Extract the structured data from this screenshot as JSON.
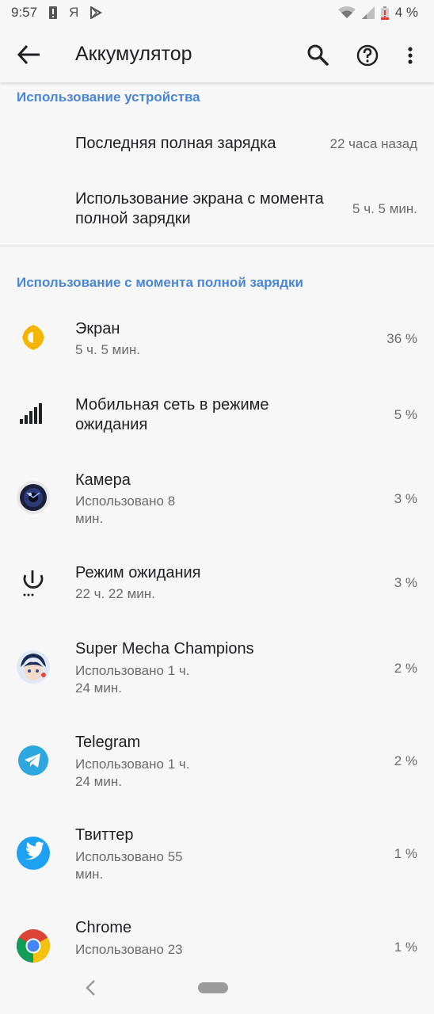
{
  "status_bar": {
    "time": "9:57",
    "notif_icons": [
      "alert-icon",
      "yandex-icon",
      "play-store-icon"
    ],
    "battery_percent": "4 %"
  },
  "app_bar": {
    "title": "Аккумулятор"
  },
  "device_usage": {
    "header": "Использование устройства",
    "rows": [
      {
        "title": "Последняя полная зарядка",
        "value": "22 часа назад"
      },
      {
        "title": "Использование экрана с момента полной зарядки",
        "title_line1": "Использование экрана с момента",
        "title_line2": "полной зарядки",
        "value": "5 ч. 5 мин."
      }
    ]
  },
  "since_full_charge": {
    "header": "Использование с момента полной зарядки",
    "items": [
      {
        "icon": "brightness-icon",
        "title": "Экран",
        "subtitle": "5 ч. 5 мин.",
        "percent": "36 %"
      },
      {
        "icon": "cell-signal-icon",
        "title_line1": "Мобильная сеть в режиме",
        "title_line2": "ожидания",
        "percent": "5 %"
      },
      {
        "icon": "camera-app-icon",
        "title": "Камера",
        "subtitle_line1": "Использовано 8",
        "subtitle_line2": "мин.",
        "percent": "3 %"
      },
      {
        "icon": "power-icon",
        "title": "Режим ожидания",
        "subtitle": "22 ч. 22 мин.",
        "percent": "3 %"
      },
      {
        "icon": "super-mecha-champions-app-icon",
        "title": "Super Mecha Champions",
        "subtitle_line1": "Использовано 1 ч.",
        "subtitle_line2": "24 мин.",
        "percent": "2 %"
      },
      {
        "icon": "telegram-app-icon",
        "title": "Telegram",
        "subtitle_line1": "Использовано 1 ч.",
        "subtitle_line2": "24 мин.",
        "percent": "2 %"
      },
      {
        "icon": "twitter-app-icon",
        "title": "Твиттер",
        "subtitle_line1": "Использовано 55",
        "subtitle_line2": "мин.",
        "percent": "1 %"
      },
      {
        "icon": "chrome-app-icon",
        "title": "Chrome",
        "subtitle_line1": "Использовано 23",
        "percent": "1 %"
      }
    ]
  },
  "colors": {
    "accent": "#4a86d8",
    "background": "#f7f7f7",
    "primary_text": "#202124",
    "secondary_text": "#6b6b6b"
  }
}
